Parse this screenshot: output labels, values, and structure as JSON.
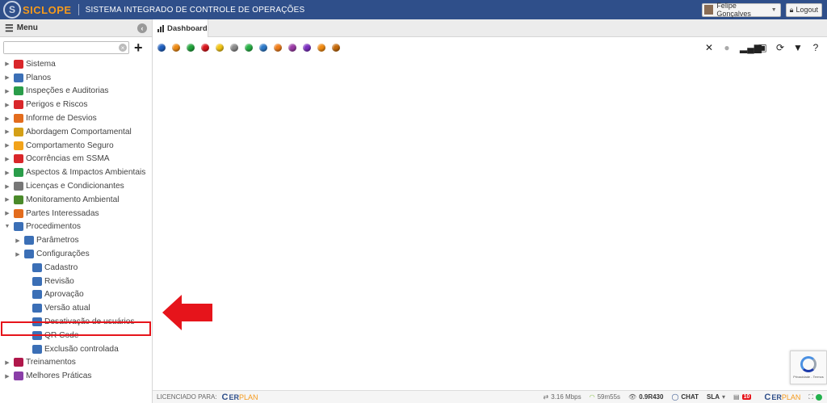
{
  "header": {
    "logo": "SICLOPE",
    "system_title": "SISTEMA INTEGRADO DE CONTROLE DE OPERAÇÕES",
    "user_name": "Felipe Gonçalves",
    "logout_label": "Logout"
  },
  "sidebar": {
    "title": "Menu",
    "search_value": "",
    "items": [
      {
        "label": "Sistema",
        "icon": "gear-icon",
        "color": "#d9262a"
      },
      {
        "label": "Planos",
        "icon": "calendar-icon",
        "color": "#3b6fb6"
      },
      {
        "label": "Inspeções e Auditorias",
        "icon": "checklist-icon",
        "color": "#2a9d4a"
      },
      {
        "label": "Perigos e Riscos",
        "icon": "warning-icon",
        "color": "#d9262a"
      },
      {
        "label": "Informe de Desvios",
        "icon": "phone-icon",
        "color": "#e36c1d"
      },
      {
        "label": "Abordagem Comportamental",
        "icon": "diamond-icon",
        "color": "#d4a017"
      },
      {
        "label": "Comportamento Seguro",
        "icon": "helmet-icon",
        "color": "#f2a31b"
      },
      {
        "label": "Ocorrências em SSMA",
        "icon": "person-fall-icon",
        "color": "#d9262a"
      },
      {
        "label": "Aspectos & Impactos Ambientais",
        "icon": "recycle-icon",
        "color": "#2a9d4a"
      },
      {
        "label": "Licenças e Condicionantes",
        "icon": "document-icon",
        "color": "#777777"
      },
      {
        "label": "Monitoramento Ambiental",
        "icon": "tree-icon",
        "color": "#4a8a2a"
      },
      {
        "label": "Partes Interessadas",
        "icon": "people-icon",
        "color": "#e36c1d"
      },
      {
        "label": "Procedimentos",
        "icon": "folder-icon",
        "color": "#3b6fb6",
        "expanded": true
      }
    ],
    "procedimentos_children": [
      {
        "label": "Parâmetros",
        "icon": "gear-icon",
        "color": "#3b6fb6",
        "has_children": true
      },
      {
        "label": "Configurações",
        "icon": "sliders-icon",
        "color": "#3b6fb6",
        "has_children": true
      },
      {
        "label": "Cadastro",
        "icon": "edit-icon",
        "color": "#3b6fb6"
      },
      {
        "label": "Revisão",
        "icon": "thumbs-up-icon",
        "color": "#3b6fb6"
      },
      {
        "label": "Aprovação",
        "icon": "approve-icon",
        "color": "#3b6fb6"
      },
      {
        "label": "Versão atual",
        "icon": "file-icon",
        "color": "#3b6fb6"
      },
      {
        "label": "Desativação de usuários",
        "icon": "users-icon",
        "color": "#3b6fb6"
      },
      {
        "label": "QR Code",
        "icon": "qr-icon",
        "color": "#3b6fb6"
      },
      {
        "label": "Exclusão controlada",
        "icon": "trash-icon",
        "color": "#3b6fb6"
      }
    ],
    "bottom_items": [
      {
        "label": "Treinamentos",
        "icon": "trainer-icon",
        "color": "#b0174b"
      },
      {
        "label": "Melhores Práticas",
        "icon": "people-icon",
        "color": "#8a3ea8"
      }
    ]
  },
  "tabs": [
    {
      "label": "Dashboard",
      "icon": "bar-chart-icon"
    }
  ],
  "status_dots": [
    "#1f5fbf",
    "#ef8a12",
    "#20a33a",
    "#d9141b",
    "#f2c413",
    "#8a8a8a",
    "#27b045",
    "#2b79c9",
    "#f07d1a",
    "#9b3aa6",
    "#7b2fc0",
    "#f28a10",
    "#c66a0a"
  ],
  "toolbar_icons": [
    "close-icon",
    "circle-icon",
    "signal-icon",
    "monitor-icon",
    "refresh-icon",
    "filter-icon",
    "help-icon"
  ],
  "footer": {
    "licensed_label": "LICENCIADO PARA:",
    "erplan_er": "ER",
    "erplan_plan": "PLAN",
    "speed": "3.16 Mbps",
    "session_time": "59m55s",
    "version": "0.9R430",
    "chat": "CHAT",
    "sla": "SLA",
    "badge_count": "10"
  },
  "recaptcha_text": "Privacidade - Termos",
  "accent_color": "#2f4f8a",
  "highlight_color": "#e6141b"
}
